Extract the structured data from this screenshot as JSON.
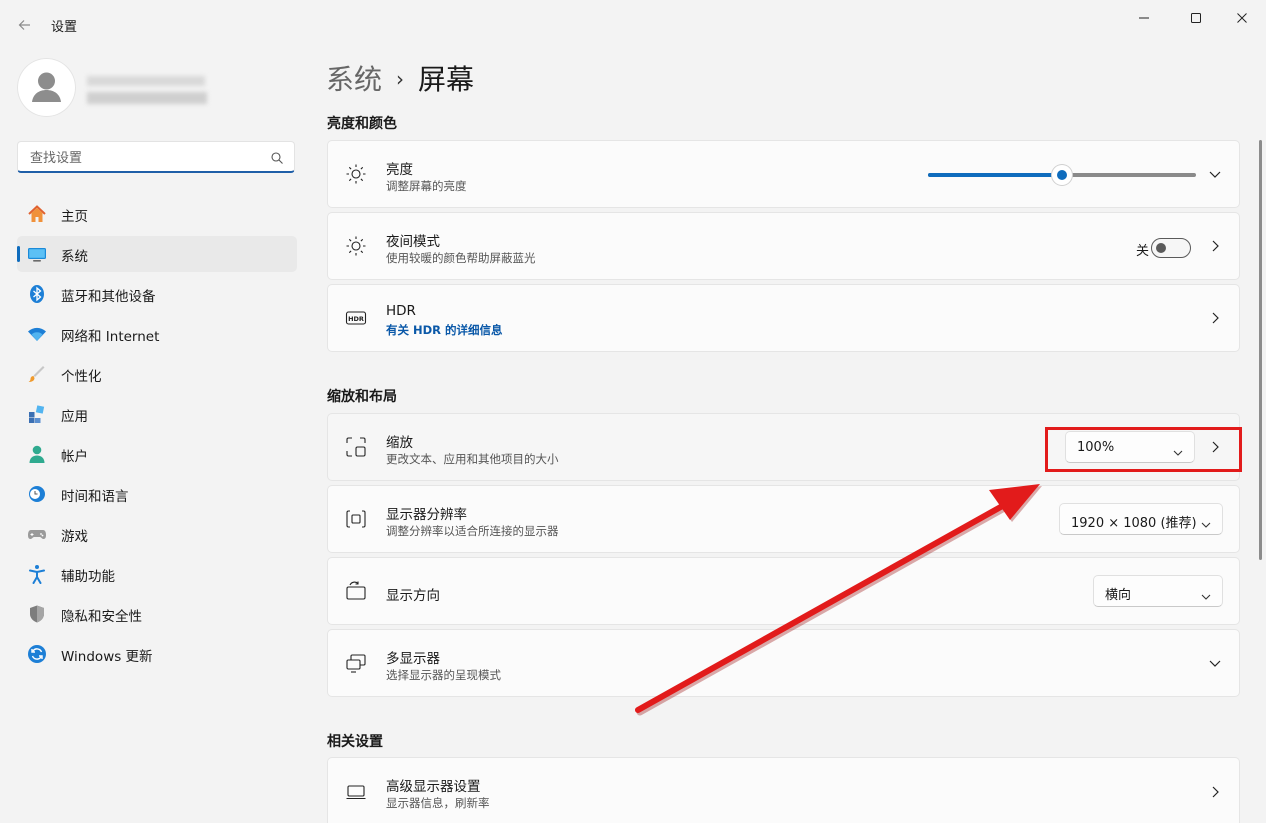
{
  "window": {
    "title": "设置"
  },
  "search": {
    "placeholder": "查找设置"
  },
  "sidebar": {
    "items": [
      {
        "label": "主页",
        "icon": "home-icon"
      },
      {
        "label": "系统",
        "icon": "system-icon",
        "selected": true
      },
      {
        "label": "蓝牙和其他设备",
        "icon": "bluetooth-icon"
      },
      {
        "label": "网络和 Internet",
        "icon": "wifi-icon"
      },
      {
        "label": "个性化",
        "icon": "brush-icon"
      },
      {
        "label": "应用",
        "icon": "apps-icon"
      },
      {
        "label": "帐户",
        "icon": "account-icon"
      },
      {
        "label": "时间和语言",
        "icon": "clock-globe-icon"
      },
      {
        "label": "游戏",
        "icon": "gamepad-icon"
      },
      {
        "label": "辅助功能",
        "icon": "accessibility-icon"
      },
      {
        "label": "隐私和安全性",
        "icon": "shield-icon"
      },
      {
        "label": "Windows 更新",
        "icon": "update-icon"
      }
    ]
  },
  "breadcrumb": {
    "parent": "系统",
    "current": "屏幕"
  },
  "sections": {
    "brightness_color": "亮度和颜色",
    "scale_layout": "缩放和布局",
    "related": "相关设置"
  },
  "cards": {
    "brightness": {
      "title": "亮度",
      "subtitle": "调整屏幕的亮度",
      "value": 0.5
    },
    "night_light": {
      "title": "夜间模式",
      "subtitle": "使用较暖的颜色帮助屏蔽蓝光",
      "state_label": "关",
      "on": false
    },
    "hdr": {
      "title": "HDR",
      "link": "有关 HDR 的详细信息"
    },
    "scale": {
      "title": "缩放",
      "subtitle": "更改文本、应用和其他项目的大小",
      "value": "100%"
    },
    "resolution": {
      "title": "显示器分辨率",
      "subtitle": "调整分辨率以适合所连接的显示器",
      "value": "1920 × 1080 (推荐)"
    },
    "orientation": {
      "title": "显示方向",
      "value": "横向"
    },
    "multi_display": {
      "title": "多显示器",
      "subtitle": "选择显示器的呈现模式"
    },
    "advanced_display": {
      "title": "高级显示器设置",
      "subtitle": "显示器信息，刷新率"
    }
  },
  "colors": {
    "accent": "#0f6cbd",
    "annotation": "#e21b1b"
  }
}
